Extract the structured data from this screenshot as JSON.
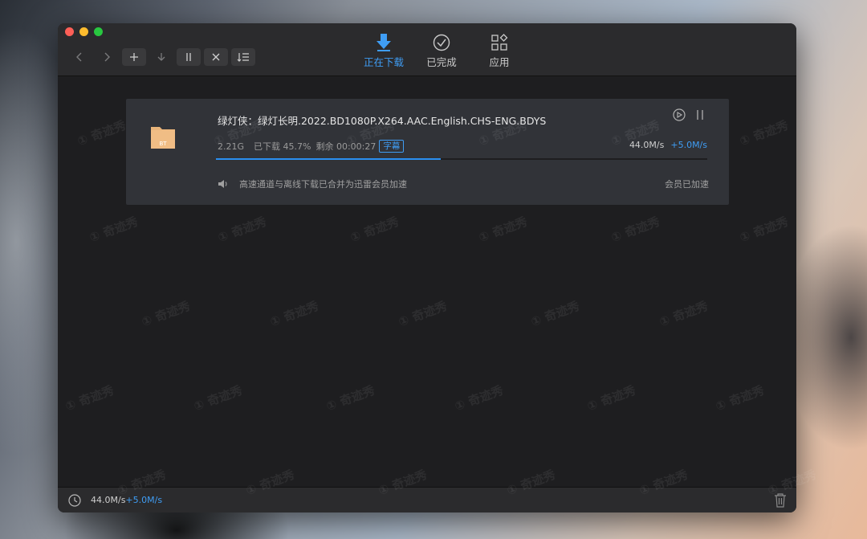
{
  "toolbar": {
    "buttons": [
      {
        "name": "back-button",
        "glyph": "‹"
      },
      {
        "name": "forward-button",
        "glyph": "›"
      },
      {
        "name": "add-button",
        "glyph": "+"
      },
      {
        "name": "download-button",
        "glyph": "↓"
      },
      {
        "name": "pause-all-button",
        "glyph": "❙❙"
      },
      {
        "name": "delete-button",
        "glyph": "✕"
      },
      {
        "name": "sort-button",
        "glyph": "↕☰"
      }
    ]
  },
  "tabs": [
    {
      "label": "正在下载",
      "icon": "download-arrow-icon",
      "active": true
    },
    {
      "label": "已完成",
      "icon": "check-circle-icon",
      "active": false
    },
    {
      "label": "应用",
      "icon": "apps-grid-icon",
      "active": false
    }
  ],
  "task": {
    "name": "绿灯侠：绿灯长明.2022.BD1080P.X264.AAC.English.CHS-ENG.BDYS",
    "file_icon_label": "BT",
    "size": "2.21G",
    "downloaded": "已下载 45.7%",
    "remaining": "剩余 00:00:27",
    "subtitle_badge": "字幕",
    "speed": "44.0M/s",
    "bonus_speed": "+5.0M/s",
    "progress": 0.457,
    "notice": "高速通道与离线下载已合并为迅雷会员加速",
    "vip_status": "会员已加速"
  },
  "status": {
    "speed": "44.0M/s",
    "bonus_speed": "+5.0M/s"
  },
  "watermark": "奇迹秀",
  "colors": {
    "accent": "#3f9df4",
    "folder": "#e9b47a"
  }
}
